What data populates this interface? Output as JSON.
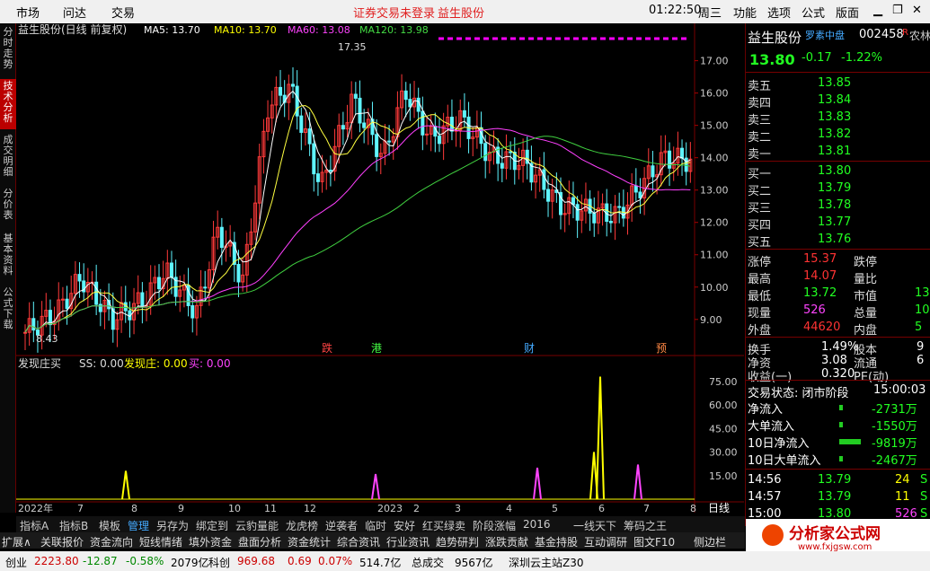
{
  "topbar": {
    "market": "市场",
    "wenda": "问达",
    "trade": "交易",
    "notice": "证券交易未登录",
    "stock_name_top": "益生股份",
    "time": "01:22:50",
    "weekday": "周三",
    "func": "功能",
    "options": "选项",
    "formula": "公式",
    "layout": "版面"
  },
  "vtabs": [
    "分时走势",
    "技术分析",
    "成交明细",
    "分价表",
    "基本资料",
    "公式下载"
  ],
  "main": {
    "title": "益生股份(日线 前复权)",
    "ma5": "MA5: 13.70",
    "ma10": "MA10: 13.70",
    "ma60": "MA60: 13.08",
    "ma120": "MA120: 13.98",
    "high_label": "17.35",
    "low_label": "8.43",
    "yticks": [
      "17.00",
      "16.00",
      "15.00",
      "14.00",
      "13.00",
      "12.00",
      "11.00",
      "10.00",
      "9.00"
    ],
    "events": [
      "跌",
      "港",
      "财",
      "预"
    ],
    "colors": {
      "up": "#ff3a3a",
      "down": "#5ff5ff",
      "ma5": "#ffffff",
      "ma10": "#ffff40",
      "ma60": "#ff40ff",
      "ma120": "#40d040"
    }
  },
  "indicator": {
    "name": "发现庄买",
    "ss": "SS: 0.00",
    "fx": "发现庄: 0.00",
    "buy": "买: 0.00",
    "yticks": [
      "75.00",
      "60.00",
      "45.00",
      "30.00",
      "15.00"
    ],
    "xticks": [
      "2022年",
      "7",
      "8",
      "9",
      "10",
      "11",
      "12",
      "2023",
      "2",
      "3",
      "4",
      "5",
      "6",
      "7",
      "8"
    ],
    "period": "日线"
  },
  "bottom_tabs": [
    "指标A",
    "指标B",
    "模板",
    "管理",
    "另存为",
    "绑定到",
    "云豹量能",
    "龙虎榜",
    "逆袭者",
    "临时",
    "安好",
    "红买绿卖",
    "阶段涨幅",
    "2016",
    "一线天下",
    "筹码之王"
  ],
  "tabs2": [
    "扩展∧",
    "关联报价",
    "资金流向",
    "短线情绪",
    "填外资金",
    "盘面分析",
    "资金统计",
    "综合资讯",
    "行业资讯",
    "趋势研判",
    "涨跌贡献",
    "基金持股",
    "互动调研",
    "图文F10",
    "侧边栏"
  ],
  "right": {
    "name": "益生股份",
    "tag": "罗素中盘",
    "code": "002458",
    "r": "R",
    "price": "13.80",
    "chg": "-0.17",
    "pct": "-1.22%",
    "side": "农林",
    "asks": [
      {
        "l": "卖五",
        "p": "13.85"
      },
      {
        "l": "卖四",
        "p": "13.84"
      },
      {
        "l": "卖三",
        "p": "13.83"
      },
      {
        "l": "卖二",
        "p": "13.82"
      },
      {
        "l": "卖一",
        "p": "13.81"
      }
    ],
    "bids": [
      {
        "l": "买一",
        "p": "13.80"
      },
      {
        "l": "买二",
        "p": "13.79"
      },
      {
        "l": "买三",
        "p": "13.78"
      },
      {
        "l": "买四",
        "p": "13.77"
      },
      {
        "l": "买五",
        "p": "13.76"
      }
    ],
    "stats": [
      {
        "a": "涨停",
        "av": "15.37",
        "b": "跌停",
        "bv": ""
      },
      {
        "a": "最高",
        "av": "14.07",
        "b": "量比",
        "bv": ""
      },
      {
        "a": "最低",
        "av": "13.72",
        "b": "市值",
        "bv": "13"
      },
      {
        "a": "现量",
        "av": "526",
        "b": "总量",
        "bv": "10"
      },
      {
        "a": "外盘",
        "av": "44620",
        "b": "内盘",
        "bv": "5"
      }
    ],
    "stats2": [
      {
        "a": "换手",
        "av": "1.49%",
        "b": "股本",
        "bv": "9"
      },
      {
        "a": "净资",
        "av": "3.08",
        "b": "流通",
        "bv": "6"
      },
      {
        "a": "收益(一)",
        "av": "0.320",
        "b": "PE(动)",
        "bv": ""
      }
    ],
    "status": "交易状态: 闭市阶段",
    "status_time": "15:00:03",
    "flows": [
      {
        "l": "净流入",
        "v": "-2731万"
      },
      {
        "l": "大单流入",
        "v": "-1550万"
      },
      {
        "l": "10日净流入",
        "v": "-9819万"
      },
      {
        "l": "10日大单流入",
        "v": "-2467万"
      }
    ],
    "ticks": [
      {
        "t": "14:56",
        "p": "13.79",
        "v": "24",
        "s": "S"
      },
      {
        "t": "14:57",
        "p": "13.79",
        "v": "11",
        "s": "S"
      },
      {
        "t": "15:00",
        "p": "13.80",
        "v": "526",
        "s": "S"
      }
    ]
  },
  "status": {
    "cy": "创业",
    "cy_v": "2223.80",
    "cy_c": "-12.87",
    "cy_p": "-0.58%",
    "cy_a": "2079亿",
    "kc": "科创",
    "kc_v": "969.68",
    "kc_c": "0.69",
    "kc_p": "0.07%",
    "kc_a": "514.7亿",
    "total_l": "总成交",
    "total": "9567亿",
    "site": "深圳云主站Z30"
  },
  "logo": {
    "text": "分析家公式网",
    "url": "www.fxjgsw.com"
  }
}
